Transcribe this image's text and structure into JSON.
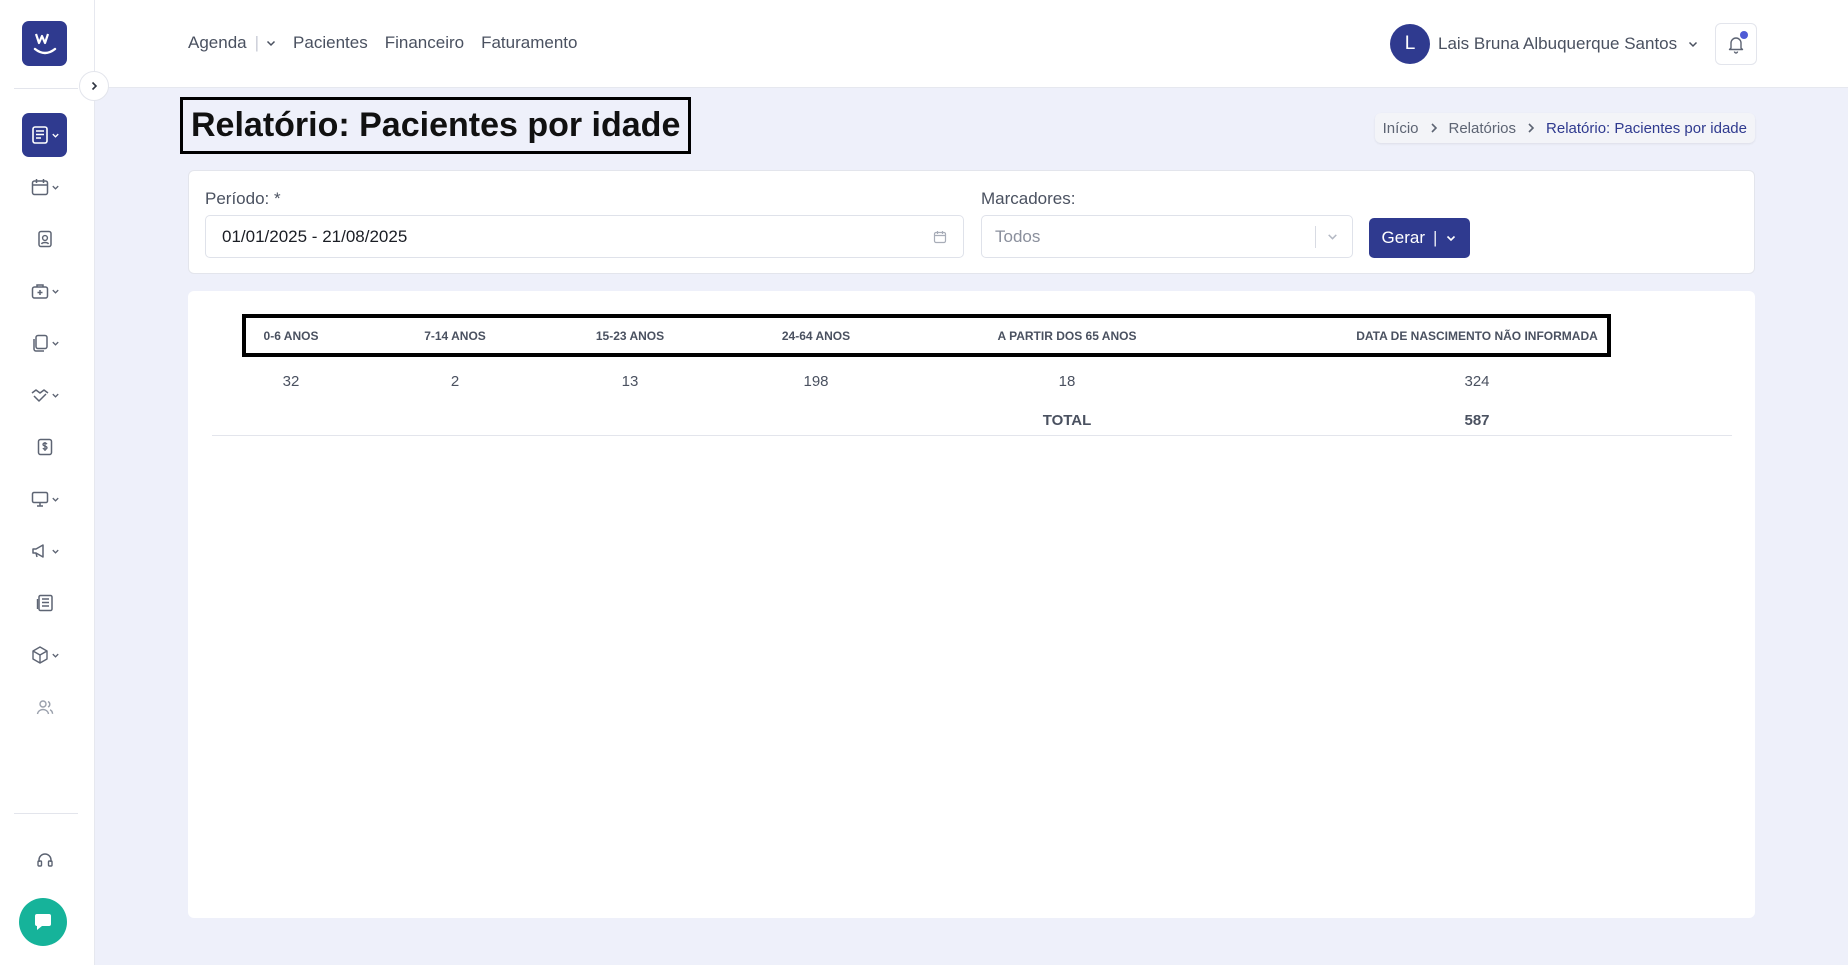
{
  "topnav": {
    "agenda": "Agenda",
    "pacientes": "Pacientes",
    "financeiro": "Financeiro",
    "faturamento": "Faturamento"
  },
  "user": {
    "initial": "L",
    "name": "Lais Bruna Albuquerque Santos"
  },
  "page": {
    "title": "Relatório: Pacientes por idade"
  },
  "breadcrumb": {
    "home": "Início",
    "reports": "Relatórios",
    "current": "Relatório: Pacientes por idade"
  },
  "filters": {
    "period_label": "Período: *",
    "period_value": "01/01/2025 - 21/08/2025",
    "markers_label": "Marcadores:",
    "markers_value": "Todos",
    "generate_label": "Gerar"
  },
  "report": {
    "columns": [
      {
        "header": "0-6 ANOS",
        "value": "32"
      },
      {
        "header": "7-14 ANOS",
        "value": "2"
      },
      {
        "header": "15-23 ANOS",
        "value": "13"
      },
      {
        "header": "24-64 ANOS",
        "value": "198"
      },
      {
        "header": "A PARTIR DOS 65 ANOS",
        "value": "18"
      },
      {
        "header": "DATA DE NASCIMENTO NÃO INFORMADA",
        "value": "324"
      }
    ],
    "total_label": "TOTAL",
    "total_value": "587"
  },
  "colors": {
    "primary": "#2f3a8f",
    "chat": "#16b39a",
    "background": "#eef0fa"
  }
}
